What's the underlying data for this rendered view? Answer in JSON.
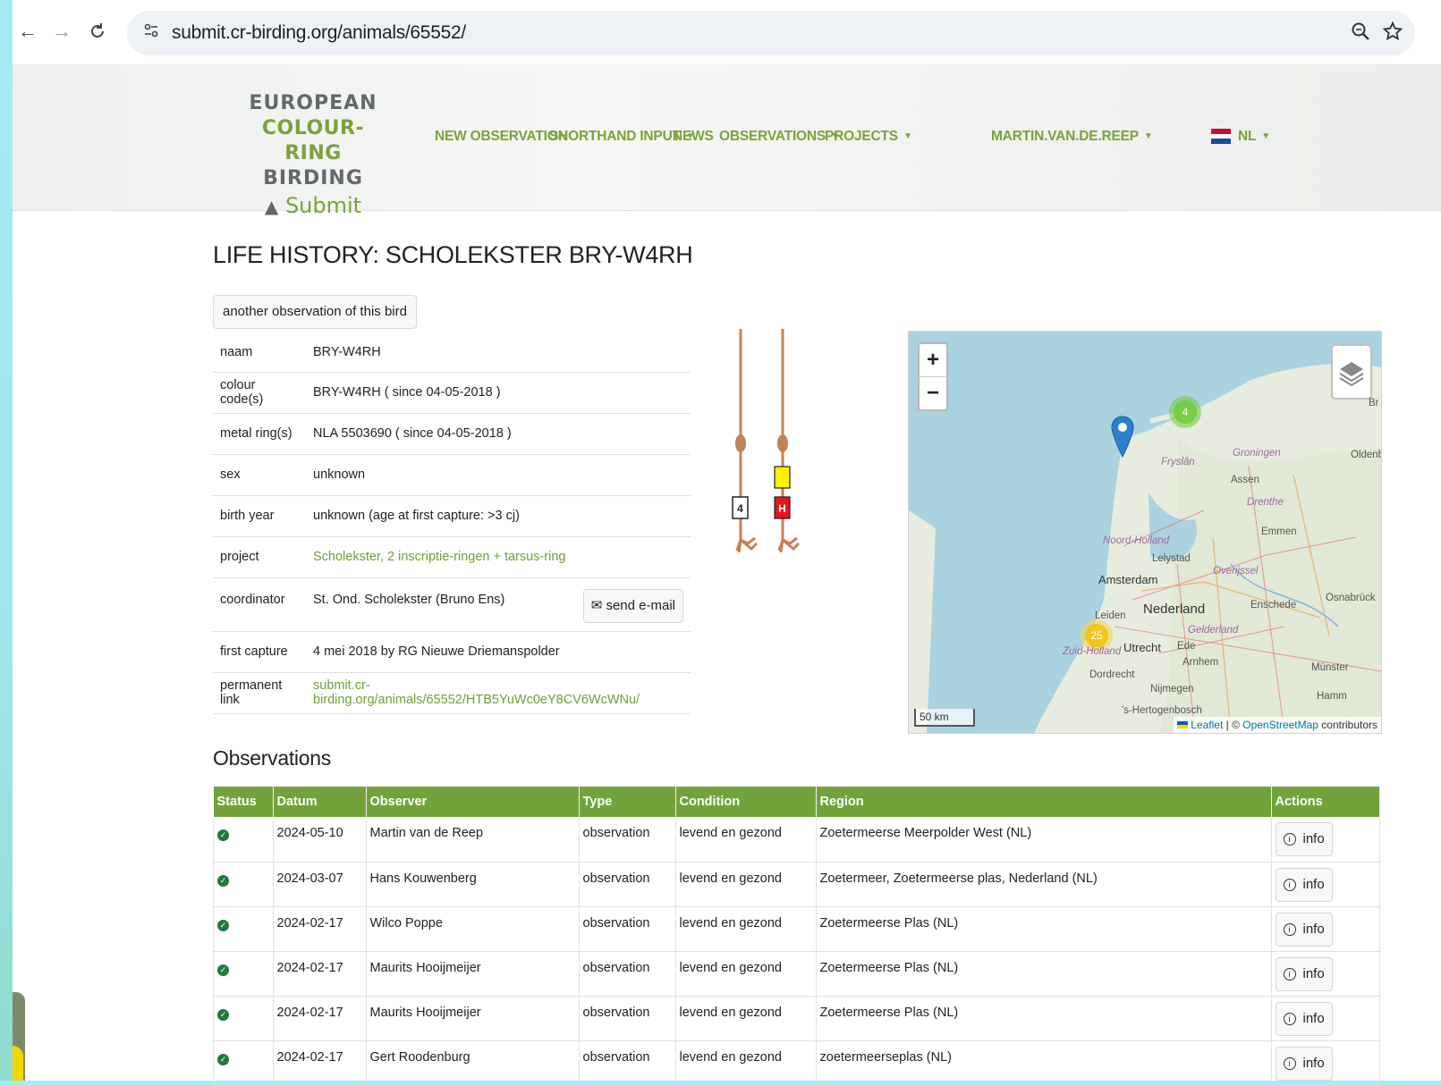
{
  "browser": {
    "url": "submit.cr-birding.org/animals/65552/",
    "back": "←",
    "forward": "→",
    "reload": "C",
    "zoom_icon": "magnifier-icon",
    "star_icon": "star-icon"
  },
  "logo": {
    "line1": "EUROPEAN",
    "line2": "COLOUR-RING",
    "line3": "BIRDING",
    "line4": "Submit"
  },
  "nav": {
    "new_observation": "NEW OBSERVATION",
    "shorthand_input": "SHORTHAND INPUT",
    "news": "NEWS",
    "observations": "OBSERVATIONS",
    "projects": "PROJECTS",
    "user": "MARTIN.VAN.DE.REEP",
    "language": "NL"
  },
  "page": {
    "title": "LIFE HISTORY: SCHOLEKSTER BRY-W4RH",
    "another_button": "another observation of this bird"
  },
  "details": [
    {
      "key": "naam",
      "value": "BRY-W4RH"
    },
    {
      "key": "colour code(s)",
      "value": "BRY-W4RH ( since 04-05-2018 )"
    },
    {
      "key": "metal ring(s)",
      "value": "NLA 5503690 ( since 04-05-2018 )"
    },
    {
      "key": "sex",
      "value": "unknown"
    },
    {
      "key": "birth year",
      "value": "unknown (age at first capture: >3 cj)"
    },
    {
      "key": "project",
      "value": "Scholekster, 2 inscriptie-ringen + tarsus-ring"
    },
    {
      "key": "coordinator",
      "value": "St. Ond. Scholekster (Bruno Ens)"
    },
    {
      "key": "first capture",
      "value": "4 mei 2018 by RG Nieuwe Driemanspolder"
    },
    {
      "key": "permanent link",
      "value": "submit.cr-birding.org/animals/65552/HTB5YuWc0eY8CV6WcWNu/"
    }
  ],
  "send_email": "send e-mail",
  "rings": {
    "left_label": "4",
    "right_label": "H",
    "colors": {
      "ring_yellow": "#ffef00",
      "ring_red": "#e8141e",
      "leg": "#c28257"
    }
  },
  "map": {
    "zoom_in": "+",
    "zoom_out": "−",
    "scale": "50 km",
    "cluster_green": "4",
    "cluster_yellow": "25",
    "labels": [
      "Groningen",
      "Fryslân",
      "Assen",
      "Drenthe",
      "Emmen",
      "Oldenbu",
      "Noord-Holland",
      "Lelystad",
      "Overijssel",
      "Amsterdam",
      "Nederland",
      "Enschede",
      "Osnabrück",
      "Leiden",
      "Gelderland",
      "Zuid-Holland",
      "Utrecht",
      "Ede",
      "Arnhem",
      "Dordrecht",
      "Nijmegen",
      "Münster",
      "Hamm",
      "'s-Hertogenbosch",
      "Br"
    ],
    "attrib_leaflet": "Leaflet",
    "attrib_sep": " | © ",
    "attrib_osm": "OpenStreetMap",
    "attrib_contrib": " contributors"
  },
  "observations": {
    "title": "Observations",
    "headers": [
      "Status",
      "Datum",
      "Observer",
      "Type",
      "Condition",
      "Region",
      "Actions"
    ],
    "info_label": "info",
    "rows": [
      {
        "date": "2024-05-10",
        "observer": "Martin van de Reep",
        "type": "observation",
        "condition": "levend en gezond",
        "region": "Zoetermeerse Meerpolder West (NL)"
      },
      {
        "date": "2024-03-07",
        "observer": "Hans Kouwenberg",
        "type": "observation",
        "condition": "levend en gezond",
        "region": "Zoetermeer, Zoetermeerse plas, Nederland (NL)"
      },
      {
        "date": "2024-02-17",
        "observer": "Wilco Poppe",
        "type": "observation",
        "condition": "levend en gezond",
        "region": "Zoetermeerse Plas (NL)"
      },
      {
        "date": "2024-02-17",
        "observer": "Maurits Hooijmeijer",
        "type": "observation",
        "condition": "levend en gezond",
        "region": "Zoetermeerse Plas (NL)"
      },
      {
        "date": "2024-02-17",
        "observer": "Maurits Hooijmeijer",
        "type": "observation",
        "condition": "levend en gezond",
        "region": "Zoetermeerse Plas (NL)"
      },
      {
        "date": "2024-02-17",
        "observer": "Gert Roodenburg",
        "type": "observation",
        "condition": "levend en gezond",
        "region": "zoetermeerseplas (NL)"
      }
    ]
  },
  "colors": {
    "brand_green": "#72a33a",
    "link_green": "#6f9e3a",
    "status_green": "#1f7a3d"
  }
}
